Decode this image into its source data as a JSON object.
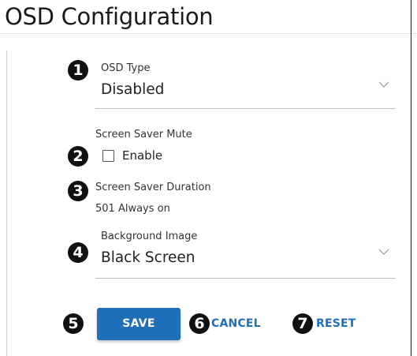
{
  "page": {
    "title": "OSD Configuration"
  },
  "badges": [
    "1",
    "2",
    "3",
    "4",
    "5",
    "6",
    "7"
  ],
  "osd_type": {
    "label": "OSD Type",
    "value": "Disabled",
    "icon": "chevron-down-icon"
  },
  "screen_saver_mute": {
    "label": "Screen Saver Mute",
    "checkbox_label": "Enable",
    "checked": false
  },
  "screen_saver_duration": {
    "label": "Screen Saver Duration",
    "value": "501 Always on"
  },
  "background_image": {
    "label": "Background Image",
    "value": "Black Screen",
    "icon": "chevron-down-icon"
  },
  "actions": {
    "save": "SAVE",
    "cancel": "CANCEL",
    "reset": "RESET"
  },
  "colors": {
    "primary": "#1f6fb9",
    "badge": "#111111"
  }
}
